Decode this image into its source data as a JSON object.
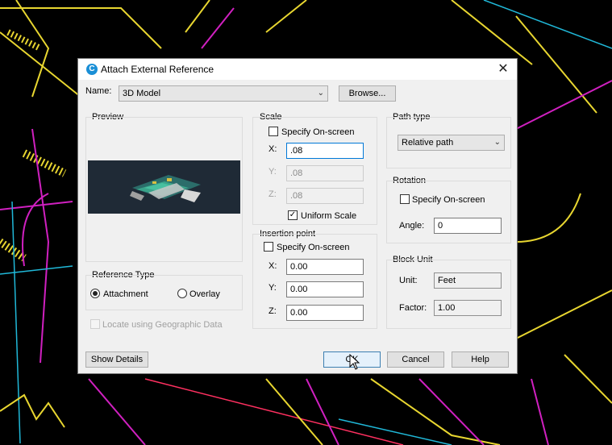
{
  "dialog": {
    "title": "Attach External Reference",
    "close_glyph": "✕",
    "icon_glyph": "C"
  },
  "name": {
    "label": "Name:",
    "value": "3D Model",
    "browse_label": "Browse..."
  },
  "preview": {
    "label": "Preview"
  },
  "scale": {
    "label": "Scale",
    "specify_label": "Specify On-screen",
    "x_label": "X:",
    "x_value": ".08",
    "y_label": "Y:",
    "y_value": ".08",
    "z_label": "Z:",
    "z_value": ".08",
    "uniform_label": "Uniform Scale",
    "uniform_checked": true
  },
  "insertion": {
    "label": "Insertion point",
    "specify_label": "Specify On-screen",
    "x_label": "X:",
    "x_value": "0.00",
    "y_label": "Y:",
    "y_value": "0.00",
    "z_label": "Z:",
    "z_value": "0.00"
  },
  "path_type": {
    "label": "Path type",
    "value": "Relative path"
  },
  "rotation": {
    "label": "Rotation",
    "specify_label": "Specify On-screen",
    "angle_label": "Angle:",
    "angle_value": "0"
  },
  "block_unit": {
    "label": "Block Unit",
    "unit_label": "Unit:",
    "unit_value": "Feet",
    "factor_label": "Factor:",
    "factor_value": "1.00"
  },
  "reference_type": {
    "label": "Reference Type",
    "attachment_label": "Attachment",
    "overlay_label": "Overlay",
    "selected": "Attachment"
  },
  "geo": {
    "label": "Locate using Geographic Data"
  },
  "buttons": {
    "show_details": "Show Details",
    "ok": "OK",
    "cancel": "Cancel",
    "help": "Help"
  },
  "colors": {
    "accent": "#0078d7",
    "cad_yellow": "#e8d630",
    "cad_magenta": "#d020c0",
    "cad_cyan": "#20b8d8"
  }
}
